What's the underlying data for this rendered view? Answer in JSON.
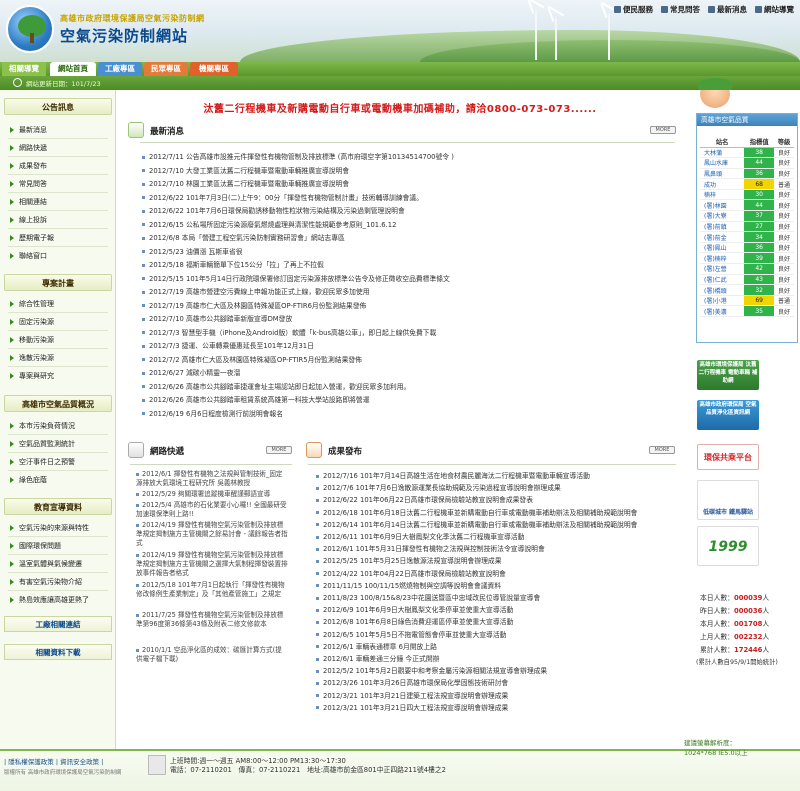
{
  "header": {
    "subtitle": "高雄市政府環境保護局空氣污染防制網",
    "title": "空氣污染防制網站",
    "top_links": [
      "便民服務",
      "常見問答",
      "最新消息",
      "網站導覽"
    ]
  },
  "nav": {
    "tabs": [
      "相關導覽",
      "網站首頁",
      "工廠專區",
      "民眾專區",
      "機關專區"
    ],
    "update_label": "網站更新日期：101/7/23"
  },
  "left": {
    "announce_title": "公告訊息",
    "announce_items": [
      "最新消息",
      "網路快遞",
      "成果發布",
      "常見問答",
      "相關連結",
      "線上投訴",
      "歷期電子報",
      "聯絡窗口"
    ],
    "topic_title": "專案計畫",
    "topic_items": [
      "綜合性管理",
      "固定污染源",
      "移動污染源",
      "逸散污染源",
      "專案與研究"
    ],
    "aq_title": "高雄市空氣品質概況",
    "aq_items": [
      "本市污染負荷情況",
      "空氣品質監測統計",
      "空汙事件日之預警",
      "綠色庇蔭"
    ],
    "edu_title": "教育宣導資料",
    "edu_items": [
      "空氣污染的來源與特性",
      "國際環保問題",
      "溫室氣體與氣候變遷",
      "有害空氣污染物介紹",
      "熱島效應讓高雄更熱了"
    ],
    "factory_link": "工廠相關連結",
    "download_link": "相關資料下載"
  },
  "main": {
    "marquee": "汰舊二行程機車及新購電動自行車或電動機車加碼補助，請洽0800-073-073......",
    "news_title": "最新消息",
    "more_label": "MORE",
    "news": [
      "2012/7/11 公告高雄市設推元件揮發性有機物管制及排放標準 (高市府環空字第10134514700號令 )",
      "2012/7/10 大發工業區汰舊二行程機車暨電動車輛推廣宣導說明會",
      "2012/7/10 林園工業區汰舊二行程機車暨電動車輛推廣宣導說明會",
      "2012/6/22 101年7月3日(二)上午9：00分「揮發性有機物管制計畫」技術輔導訓練會議。",
      "2012/6/22 101年7月6日環保局勸誘移動物性粒狀物污染結構及污染過剩管理說明會",
      "2012/6/15 公私場所固定污染源廢氣燃燒處理與清潔性能規範參考原則_101.6.12",
      "2012/6/8 本局「營建工程空氣污染防制實務研習會」網站志專區",
      "2012/5/23 油價漲 瓦斯車省很",
      "2012/5/18 福斯車輛簡單下位15公分「拉」了再上不拉假",
      "2012/5/15 101年5月14日行政院環保署修訂固定污染源排放標準公告令及修正徵收空品費標準條文",
      "2012/7/19 高雄市營建空污費線上申報功能正式上線，歡迎民眾多加使用",
      "2012/7/19 高雄市仁大區及林園區特殊凝區OP-FTIR6月份監測結果發佈",
      "2012/7/10 高雄市公共腳踏車新版宣導DM發放",
      "2012/7/3 智慧型手機（iPhone及Android版）軟體「k-bus高雄公車」，即日起上線供免費下載",
      "2012/7/3 捷運、公車轉乘優惠延長至101年12月31日",
      "2012/7/2 高雄市仁大區及林園區特殊凝區OP-FTIR5月份監測結果發佈",
      "2012/6/27 減碳小精靈一夜溜",
      "2012/6/26 高雄市公共腳踏車捷運會址主場認站即日起加入營運，歡迎民眾多加利用。",
      "2012/6/26 高雄市公共腳踏車租賃系統高雄第一科技大學站設路即將營運",
      "2012/6/19 6月6日程度檢測行前說明會報名"
    ],
    "netnews_title": "網路快遞",
    "netnews": [
      "2012/6/1 揮發性有機物之法規與管制技術_固定源排放大氣環境工程研究所 吳義林教授",
      "2012/5/29 夠關環署追蹤機車醒謹郵語宣導",
      "2012/5/4 高雄市的石化業要小心囉!! 全國最研受加速環保準則上路!!",
      "2012/4/19 揮發性有機物空氣污染管制及排放標準規定揭制施方主管機關之餘易討會 - 議餘報告者指式",
      "2012/4/19 揮發性有機物空氣污染管制及排放標準規定揭制施方主管機關之選擇大氣制程揮發裝置排放事件報告者格式",
      "2012/5/18 101年7月1日起執行「揮發性有機物修改條例生產業制定」及「其他產管施工」之規定",
      "2011/7/25 揮發性有機物空氣污染管制及排放標準第96度第36條第43條及附表二修文修款本",
      "2010/1/1 空品淨化區的成效：碳匯計算方式(提供電子檔下載)"
    ],
    "results_title": "成果發布",
    "results": [
      "2012/7/16 101年7月14日高雄生活在地食材農民麗海汰二行程機車暨電動車輛宣導活動",
      "2012/7/6 101年7月6日逸散源運業長協助規範及污染過程宣導說明會辦理成果",
      "2012/6/22 101年06月22日高雄市環保局檢驗站教宣說明會成果發表",
      "2012/6/18 101年6月18日汰舊二行程機車並新購電動自行車或電動機車補助辦法及相關補助規範說明會",
      "2012/6/14 101年6月14日汰舊二行程機車並新購電動自行車或電動機車補助辦法及相關補助規範說明會",
      "2012/6/11 101年6月9日大樹鳳梨文化季汰舊二行程機車宣導活動",
      "2012/6/1 101年5月31日揮發性有機物之法規與控制技術法令宣導說明會",
      "2012/5/25 101年5月25日逸散源法規宣導說明會辦理成果",
      "2012/4/22 101年04月22日高雄市環保局檢驗站教宣說明會",
      "2011/11/15 100/11/15燃燒物制與空調等說明會會議資料",
      "2011/8/23 100/8/15&8/23中花園送暨區中忠域改民位導管說量宣導會",
      "2012/6/9 101年6月9日大樹鳳梨文化季停車並使重大宣導活動",
      "2012/6/8 101年6月8日綠色消費迎運區停車並使重大宣導活動",
      "2012/6/5 101年5月5日不拖電管態會停車並使重大宣導活動",
      "2012/6/1 車輛表通標章 6月開放上路",
      "2012/6/1 車輛差通三分鐘 今正式開辦",
      "2012/5/2 101年5月2日觀要中和考察金屬污染源相關法規宣導會辦理成果",
      "2012/3/26 101年3月26日高雄市環保局化學固態技術研討會",
      "2012/3/21 101年3月21日建築工程法規宣導說明會辦理成果",
      "2012/3/21 101年3月21日四大工程法規宣導說明會辦理成果"
    ]
  },
  "right": {
    "aq_title": "高雄市空氣品質",
    "aq_headers": [
      "站名",
      "指標值",
      "等級"
    ],
    "aq_rows": [
      [
        "大林蒲",
        "38",
        "良好"
      ],
      [
        "鳳山水庫",
        "44",
        "良好"
      ],
      [
        "鳳鼻頭",
        "36",
        "良好"
      ],
      [
        "成功",
        "68",
        "普通"
      ],
      [
        "楠梓",
        "30",
        "良好"
      ],
      [
        "(署)林園",
        "44",
        "良好"
      ],
      [
        "(署)大寮",
        "37",
        "良好"
      ],
      [
        "(署)前鎮",
        "27",
        "良好"
      ],
      [
        "(署)前金",
        "34",
        "良好"
      ],
      [
        "(署)鳳山",
        "36",
        "良好"
      ],
      [
        "(署)楠梓",
        "39",
        "良好"
      ],
      [
        "(署)左營",
        "42",
        "良好"
      ],
      [
        "(署)仁武",
        "43",
        "良好"
      ],
      [
        "(署)橋頭",
        "32",
        "良好"
      ],
      [
        "(署)小港",
        "69",
        "普通"
      ],
      [
        "(署)美濃",
        "35",
        "良好"
      ]
    ],
    "banners": [
      "高雄市環境保護局 汰舊二行程機車 電動車輛 補助網",
      "高雄市政府環保局 空氣品質淨化區資訊網",
      "環保共乘平台",
      "低碳城市 鐵馬驛站",
      "1999"
    ],
    "counters": [
      {
        "label": "本日人數：",
        "value": "000039",
        "suffix": "人"
      },
      {
        "label": "昨日人數：",
        "value": "000036",
        "suffix": "人"
      },
      {
        "label": "本月人數：",
        "value": "001708",
        "suffix": "人"
      },
      {
        "label": "上月人數：",
        "value": "002232",
        "suffix": "人"
      },
      {
        "label": "累計人數：",
        "value": "172446",
        "suffix": "人"
      }
    ],
    "counter_note": "(累計人數自95/9/1開始統計)",
    "browser_note_1": "建議螢幕解析度：",
    "browser_note_2": "1024*768 IE5.0以上"
  },
  "footer": {
    "links": "| 隱私權保護政策 | 資訊安全政策 |",
    "copyright": "版權所有 高雄市政府環境保護局空氣污染防制網",
    "hours": "上班時間:週一～週五 AM8:00～12:00 PM13:30～17:30",
    "contact": "電話：07-2110201　傳真：07-2110221　地址:高雄市前金區801中正四路211號4樓之2"
  }
}
